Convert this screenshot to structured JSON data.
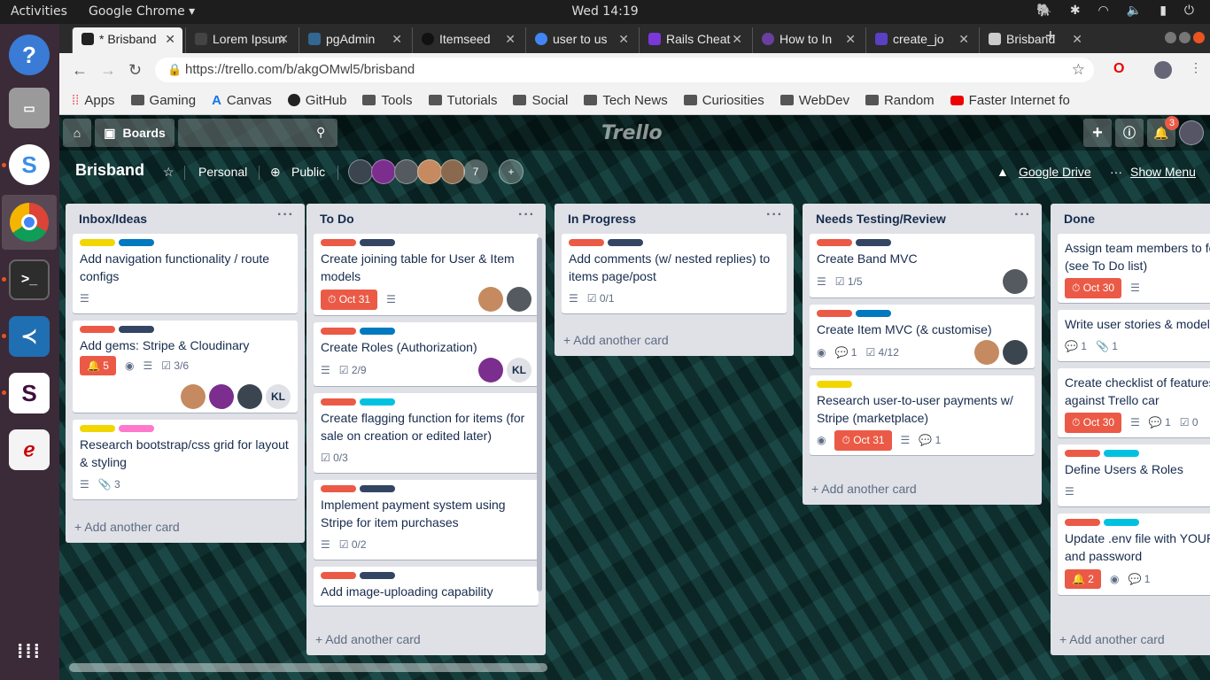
{
  "system": {
    "activities": "Activities",
    "app_menu": "Google Chrome ▾",
    "clock": "Wed 14:19"
  },
  "browser": {
    "tabs": [
      {
        "label": "* Brisband",
        "color": "#222222"
      },
      {
        "label": "Lorem Ipsum",
        "color": "#444444"
      },
      {
        "label": "pgAdmin",
        "color": "#336791"
      },
      {
        "label": "Itemseed",
        "color": "#111111"
      },
      {
        "label": "user to us",
        "color": "#4285f4"
      },
      {
        "label": "Rails Cheat",
        "color": "#7b38d8"
      },
      {
        "label": "How to In",
        "color": "#6b3fa0"
      },
      {
        "label": "create_jo",
        "color": "#5b3fc4"
      },
      {
        "label": "Brisband",
        "color": "#cccccc"
      }
    ],
    "new_tab": "+",
    "url": "https://trello.com/b/akgOMwl5/brisband",
    "bookmarks": [
      {
        "label": "Apps"
      },
      {
        "label": "Gaming"
      },
      {
        "label": "Canvas"
      },
      {
        "label": "GitHub"
      },
      {
        "label": "Tools"
      },
      {
        "label": "Tutorials"
      },
      {
        "label": "Social"
      },
      {
        "label": "Tech News"
      },
      {
        "label": "Curiosities"
      },
      {
        "label": "WebDev"
      },
      {
        "label": "Random"
      },
      {
        "label": "Faster Internet fo"
      }
    ]
  },
  "trello": {
    "boards_label": "Boards",
    "logo": "Trello",
    "notification_count": "3",
    "board": {
      "name": "Brisband",
      "team": "Personal",
      "visibility": "Public",
      "member_count": "7",
      "google_drive": "Google Drive",
      "show_menu": "Show Menu"
    },
    "add_card": "+ Add another card",
    "lists": [
      {
        "title": "Inbox/Ideas",
        "cards": [
          {
            "labels": [
              "#f2d600",
              "#0079bf"
            ],
            "title": "Add navigation functionality / route configs",
            "badges": [
              {
                "type": "desc"
              }
            ],
            "members": []
          },
          {
            "labels": [
              "#eb5a46",
              "#344563"
            ],
            "title": "Add gems: Stripe & Cloudinary",
            "badges": [
              {
                "type": "notif",
                "text": "5"
              },
              {
                "type": "watch"
              },
              {
                "type": "desc"
              },
              {
                "type": "check",
                "text": "3/6"
              }
            ],
            "members": [
              "#c58a5f",
              "#7b2e8e",
              "#3a4550",
              "KL"
            ]
          },
          {
            "labels": [
              "#f2d600",
              "#ff78cb"
            ],
            "title": "Research bootstrap/css grid for layout & styling",
            "badges": [
              {
                "type": "desc"
              },
              {
                "type": "attach",
                "text": "3"
              }
            ],
            "members": []
          }
        ]
      },
      {
        "title": "To Do",
        "cards": [
          {
            "labels": [
              "#eb5a46",
              "#344563"
            ],
            "title": "Create joining table for User & Item models",
            "badges": [
              {
                "type": "due",
                "text": "Oct 31"
              },
              {
                "type": "desc"
              }
            ],
            "members": [
              "#c58a5f",
              "#555a60"
            ]
          },
          {
            "labels": [
              "#eb5a46",
              "#0079bf"
            ],
            "title": "Create Roles (Authorization)",
            "badges": [
              {
                "type": "desc"
              },
              {
                "type": "check",
                "text": "2/9"
              }
            ],
            "members": [
              "#7b2e8e",
              "KL"
            ]
          },
          {
            "labels": [
              "#eb5a46",
              "#00c2e0"
            ],
            "title": "Create flagging function for items (for sale on creation or edited later)",
            "badges": [
              {
                "type": "check",
                "text": "0/3"
              }
            ],
            "members": []
          },
          {
            "labels": [
              "#eb5a46",
              "#344563"
            ],
            "title": "Implement payment system using Stripe for item purchases",
            "badges": [
              {
                "type": "desc"
              },
              {
                "type": "check",
                "text": "0/2"
              }
            ],
            "members": []
          },
          {
            "labels": [
              "#eb5a46",
              "#344563"
            ],
            "title": "Add image-uploading capability",
            "badges": [],
            "members": []
          }
        ]
      },
      {
        "title": "In Progress",
        "cards": [
          {
            "labels": [
              "#eb5a46",
              "#344563"
            ],
            "title": "Add comments (w/ nested replies) to items page/post",
            "badges": [
              {
                "type": "desc"
              },
              {
                "type": "check",
                "text": "0/1"
              }
            ],
            "members": []
          }
        ]
      },
      {
        "title": "Needs Testing/Review",
        "cards": [
          {
            "labels": [
              "#eb5a46",
              "#344563"
            ],
            "title": "Create Band MVC",
            "badges": [
              {
                "type": "desc"
              },
              {
                "type": "check",
                "text": "1/5"
              }
            ],
            "members": [
              "#555a60"
            ]
          },
          {
            "labels": [
              "#eb5a46",
              "#0079bf"
            ],
            "title": "Create Item MVC (& customise)",
            "badges": [
              {
                "type": "watch"
              },
              {
                "type": "comment",
                "text": "1"
              },
              {
                "type": "check",
                "text": "4/12"
              }
            ],
            "members": [
              "#c58a5f",
              "#3a4550"
            ]
          },
          {
            "labels": [
              "#f2d600"
            ],
            "title": "Research user-to-user payments w/ Stripe (marketplace)",
            "badges": [
              {
                "type": "watch"
              },
              {
                "type": "due",
                "text": "Oct 31"
              },
              {
                "type": "desc"
              },
              {
                "type": "comment",
                "text": "1"
              }
            ],
            "members": []
          }
        ]
      },
      {
        "title": "Done",
        "cards": [
          {
            "labels": [],
            "title": "Assign team members to fo tickets (see To Do list)",
            "badges": [
              {
                "type": "due",
                "text": "Oct 30"
              },
              {
                "type": "desc"
              }
            ],
            "members": []
          },
          {
            "labels": [],
            "title": "Write user stories & model",
            "badges": [
              {
                "type": "comment",
                "text": "1"
              },
              {
                "type": "attach",
                "text": "1"
              }
            ],
            "members": []
          },
          {
            "labels": [],
            "title": "Create checklist of features compare against Trello car",
            "badges": [
              {
                "type": "due",
                "text": "Oct 30"
              },
              {
                "type": "desc"
              },
              {
                "type": "comment",
                "text": "1"
              },
              {
                "type": "check",
                "text": "0"
              }
            ],
            "members": []
          },
          {
            "labels": [
              "#eb5a46",
              "#00c2e0"
            ],
            "title": "Define Users & Roles",
            "badges": [
              {
                "type": "desc"
              }
            ],
            "members": []
          },
          {
            "labels": [
              "#eb5a46",
              "#00c2e0"
            ],
            "title": "Update .env file with YOUR username and password",
            "badges": [
              {
                "type": "notif",
                "text": "2"
              },
              {
                "type": "watch"
              },
              {
                "type": "comment",
                "text": "1"
              }
            ],
            "members": [
              "#c58a5f"
            ]
          }
        ]
      }
    ]
  }
}
